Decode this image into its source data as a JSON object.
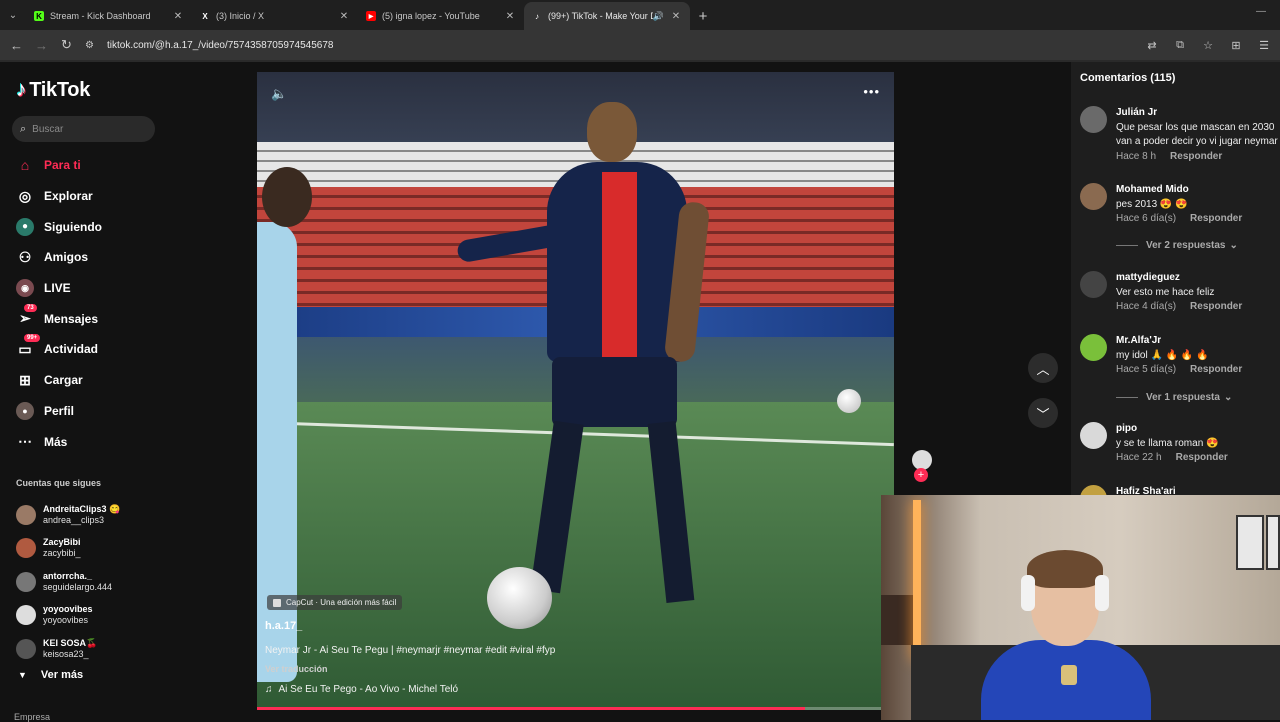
{
  "browser": {
    "tabs": [
      {
        "title": "Stream - Kick Dashboard",
        "favicon": "kick-icon",
        "color": "#53fc18",
        "active": false
      },
      {
        "title": "(3) Inicio / X",
        "favicon": "x-icon",
        "color": "#ffffff",
        "active": false
      },
      {
        "title": "(5) igna lopez - YouTube",
        "favicon": "youtube-icon",
        "color": "#ff0000",
        "active": false
      },
      {
        "title": "(99+) TikTok - Make Your Da",
        "favicon": "tiktok-icon",
        "color": "#ffffff",
        "active": true
      }
    ],
    "new_tab": "+",
    "url": "tiktok.com/@h.a.17_/video/7574358705974545678"
  },
  "sidebar": {
    "logo": "TikTok",
    "search_placeholder": "Buscar",
    "nav": [
      {
        "label": "Para ti",
        "icon": "home-icon",
        "active": true
      },
      {
        "label": "Explorar",
        "icon": "compass-icon",
        "active": false
      },
      {
        "label": "Siguiendo",
        "icon": "following-icon",
        "active": false
      },
      {
        "label": "Amigos",
        "icon": "friends-icon",
        "active": false
      },
      {
        "label": "LIVE",
        "icon": "live-icon",
        "active": false
      },
      {
        "label": "Mensajes",
        "icon": "messages-icon",
        "active": false,
        "badge": "73"
      },
      {
        "label": "Actividad",
        "icon": "activity-icon",
        "active": false,
        "badge": "99+"
      },
      {
        "label": "Cargar",
        "icon": "upload-icon",
        "active": false
      },
      {
        "label": "Perfil",
        "icon": "profile-icon",
        "active": false
      },
      {
        "label": "Más",
        "icon": "more-icon",
        "active": false
      }
    ],
    "following_title": "Cuentas que sigues",
    "following": [
      {
        "name": "AndreitaClips3 😋",
        "handle": "andrea__clips3",
        "color": "#9a7a66"
      },
      {
        "name": "ZacyBibi",
        "handle": "zacybibi_",
        "color": "#b05a40"
      },
      {
        "name": "antorrcha._",
        "handle": "seguidelargo.444",
        "color": "#777777"
      },
      {
        "name": "yoyoovibes",
        "handle": "yoyoovibes",
        "color": "#dddddd"
      },
      {
        "name": "KEI SOSA🍒",
        "handle": "keisosa23_",
        "color": "#555555"
      }
    ],
    "see_more": "Ver más",
    "cut_label": "Empresa"
  },
  "video": {
    "capcut_label": "CapCut · Una edición más fácil",
    "author": "h.a.17_",
    "description": "Neymar Jr - Ai Seu Te Pegu | #neymarjr #neymar #edit #viral #fyp",
    "translate": "Ver traducción",
    "music": "Ai Se Eu Te Pego - Ao Vivo - Michel Teló",
    "progress": 0.86
  },
  "comments": {
    "title": "Comentarios (115)",
    "reply_label": "Responder",
    "items": [
      {
        "user": "Julián Jr",
        "text1": "Que pesar los que mascan en 2030",
        "text2": "van a poder decir yo vi jugar neymar",
        "time": "Hace 8 h",
        "color": "#6a6a6a"
      },
      {
        "user": "Mohamed Mido",
        "text1": "pes 2013 😍 😍",
        "text2": "",
        "time": "Hace 6 día(s)",
        "color": "#8a6a50"
      },
      {
        "user": "mattydieguez",
        "text1": "Ver esto me hace feliz",
        "text2": "",
        "time": "Hace 4 día(s)",
        "color": "#444444"
      },
      {
        "user": "Mr.Alfa'Jr",
        "text1": "my idol 🙏 🔥 🔥 🔥",
        "text2": "",
        "time": "Hace 5 día(s)",
        "color": "#7ac03a"
      },
      {
        "user": "pipo",
        "text1": "y se te llama roman 😍",
        "text2": "",
        "time": "Hace 22 h",
        "color": "#d9d9d9"
      },
      {
        "user": "Hafiz Sha'ari",
        "text1": "",
        "text2": "",
        "time": "",
        "color": "#c2a040"
      }
    ],
    "replies": [
      "Ver 2 respuestas",
      "Ver 1 respuesta"
    ]
  },
  "icons": {
    "volume": "🔈",
    "more": "•••",
    "up": "︿",
    "down": "﹀",
    "music": "♫"
  }
}
